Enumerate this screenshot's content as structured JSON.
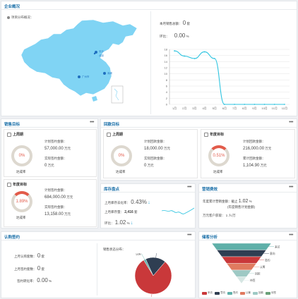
{
  "overview": {
    "title": "企业概况",
    "more": "•••",
    "map_label": "项目分布概况：",
    "month_contract_label": "本月销售总额：",
    "month_contract_value": "0",
    "month_contract_unit": "套",
    "yoy_label": "环比：",
    "yoy_value": "0.00",
    "yoy_unit": "%",
    "cities": [
      "长沙",
      "北京",
      "广州市",
      "深圳"
    ]
  },
  "chart_data": {
    "type": "line",
    "categories": [
      "1月",
      "2月",
      "3月",
      "4月",
      "5月",
      "6月",
      "7月",
      "8月",
      "9月",
      "10月",
      "11月",
      "12月"
    ],
    "series": [
      {
        "values": [
          17.5,
          15.8,
          15,
          17.2,
          15,
          0,
          0,
          0,
          0,
          0,
          0,
          0
        ]
      }
    ],
    "ylim": [
      0,
      18
    ],
    "yticks": [
      "18",
      "16",
      "14",
      "12",
      "10",
      "8",
      "6",
      "4",
      "2",
      "0"
    ],
    "color": "#2ec4e0"
  },
  "sales": {
    "title": "销售目标",
    "more": "•••",
    "half": {
      "label": "上周期",
      "pct": "0%",
      "rate_label": "达成率",
      "plan_label": "计划签约金额：",
      "plan_value": "57,000.00",
      "actual_label": "实际签约金额：",
      "actual_value": "0",
      "unit": "万元"
    },
    "year": {
      "label": "年度目标",
      "pct": "1.89%",
      "rate_label": "达成率",
      "plan_label": "计划签约金额：",
      "plan_value": "684,000.00",
      "actual_label": "实际签约金额：",
      "actual_value": "13,158.00",
      "unit": "万元"
    }
  },
  "collect": {
    "title": "回款目标",
    "more": "•••",
    "half": {
      "label": "上周期",
      "plan_label": "计划回款金额：",
      "plan_value": "18,000.00",
      "actual_label": "实际回款金额：",
      "actual_value": "0",
      "unit": "万元",
      "rate_label": "达成率",
      "pct": "0%"
    },
    "year": {
      "label": "年度目标",
      "pct": "0.51%",
      "rate_label": "达成率",
      "plan_label": "计划回款金额：",
      "plan_value": "216,000.00",
      "actual_label": "累计回款金额：",
      "actual_value": "1,104.90",
      "unit": "万元"
    }
  },
  "stock": {
    "title": "库存盘点",
    "more": "•••",
    "rate_label": "上月库存去化率：",
    "rate_value": "0.43%",
    "inv_label": "上月库存量：",
    "inv_value": "2,416",
    "inv_unit": "套",
    "hb_label": "环比：",
    "hb_value": "1.02",
    "hb_unit": "%"
  },
  "efficiency": {
    "title": "营销费效",
    "more": "•••",
    "l1": "年度累计营销金额：截止",
    "l1_value": "1.02",
    "l1_unit": "%",
    "l2": "(年度销售计划金额)",
    "l3": "万元客户获取：",
    "l3_value": "1",
    "l3_unit": "人/万"
  },
  "subscribe": {
    "title": "认购签约",
    "more": "•••",
    "a_label": "上月认购套数：",
    "a_value": "0",
    "a_unit": "套",
    "b_label": "上月签约套数：",
    "b_value": "0",
    "b_unit": "套",
    "c_label": "签约转化率：",
    "c_value": "0.00",
    "c_unit": "%",
    "pie_title": "销售状态分布：",
    "pie_labels": [
      "认购",
      "预约",
      "待售"
    ],
    "pie_values": [
      2,
      18,
      80
    ],
    "pie_colors": [
      "#5fb0a9",
      "#2f3e52",
      "#c9383a"
    ]
  },
  "customer": {
    "title": "储客分析",
    "more": "•••",
    "funnel_labels": [
      "来访",
      "意向",
      "签约",
      "认筹",
      "回款",
      "待签"
    ],
    "funnel_colors": [
      "#5fb0a9",
      "#2f3e52",
      "#c9383a",
      "#e07a5f",
      "#9ec9c4",
      "#d6e6e3"
    ],
    "legend": [
      "来访",
      "意向",
      "签约",
      "认筹",
      "回款",
      "待签"
    ],
    "legend_colors": [
      "#c9383a",
      "#2f3e52",
      "#5fb0a9",
      "#e07a5f",
      "#9ec9c4",
      "#6aa17a"
    ]
  }
}
